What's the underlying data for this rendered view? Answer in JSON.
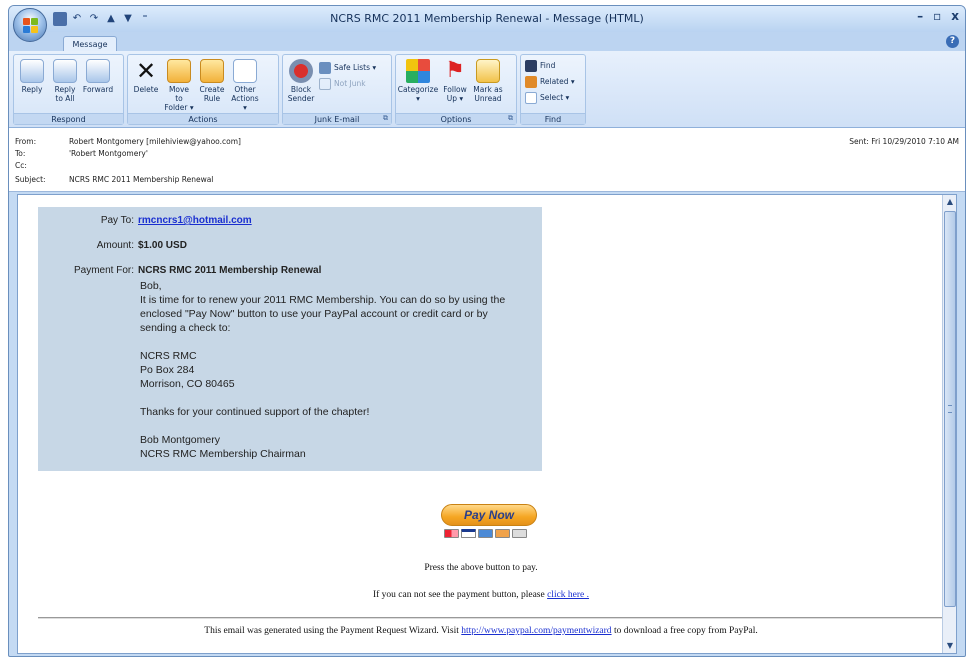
{
  "window": {
    "title": "NCRS RMC 2011 Membership Renewal - Message (HTML)",
    "minimize": "–",
    "restore": "▫",
    "close": "x"
  },
  "ribbon": {
    "tab": "Message",
    "groups": {
      "respond": {
        "label": "Respond",
        "reply": "Reply",
        "reply_all": "Reply\nto All",
        "forward": "Forward"
      },
      "actions": {
        "label": "Actions",
        "delete": "Delete",
        "move_to_folder": "Move to\nFolder ▾",
        "create_rule": "Create\nRule",
        "other_actions": "Other\nActions ▾"
      },
      "junk": {
        "label": "Junk E-mail",
        "block_sender": "Block\nSender",
        "safe_lists": "Safe Lists ▾",
        "not_junk": "Not Junk"
      },
      "options": {
        "label": "Options",
        "categorize": "Categorize\n▾",
        "follow_up": "Follow\nUp ▾",
        "mark_as_unread": "Mark as\nUnread"
      },
      "find": {
        "label": "Find",
        "find": "Find",
        "related": "Related ▾",
        "select": "Select ▾"
      }
    }
  },
  "header": {
    "from_label": "From:",
    "from_value": "Robert Montgomery [milehiview@yahoo.com]",
    "to_label": "To:",
    "to_value": "'Robert Montgomery'",
    "cc_label": "Cc:",
    "cc_value": "",
    "subject_label": "Subject:",
    "subject_value": "NCRS RMC 2011 Membership Renewal",
    "sent": "Sent:   Fri 10/29/2010 7:10 AM"
  },
  "payment": {
    "pay_to_label": "Pay To:",
    "pay_to_value": "rmcncrs1@hotmail.com",
    "amount_label": "Amount:",
    "amount_value": "$1.00 USD",
    "payment_for_label": "Payment For:",
    "payment_for_value": "NCRS RMC 2011 Membership Renewal",
    "message_lines": [
      "Bob,",
      "It is time for to renew your 2011 RMC Membership. You can do so by using the",
      "enclosed \"Pay Now\" button to use your PayPal account or credit card or by",
      "sending a check to:",
      "",
      "NCRS RMC",
      "Po Box 284",
      "Morrison, CO 80465",
      "",
      "Thanks for your continued support of the chapter!",
      "",
      "Bob Montgomery",
      "NCRS RMC Membership Chairman"
    ]
  },
  "pay_button": "Pay Now",
  "press_text": "Press the above button to pay.",
  "cant_see_text": "If you can not see the payment button, please",
  "click_here": "click here .",
  "footer_prefix": "This email was generated using the Payment Request Wizard. Visit",
  "footer_link": "http://www.paypal.com/paymentwizard",
  "footer_suffix": "to download a free copy from PayPal.",
  "colors": {
    "ribbon_bg": "#cfe0f6",
    "paybox_bg": "#c7d7e6",
    "link": "#1a2fd0",
    "paynow": "#f5a623"
  }
}
